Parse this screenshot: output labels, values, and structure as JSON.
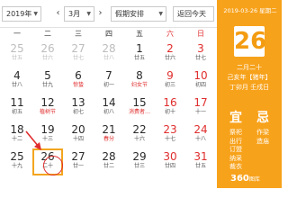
{
  "toolbar": {
    "year": "2019年",
    "prev_month_arrow": "‹",
    "month": "3月",
    "next_month_arrow": "›",
    "holiday_schedule": "假期安排",
    "back_today": "返回今天"
  },
  "weekdays": [
    "一",
    "二",
    "三",
    "四",
    "五",
    "六",
    "日"
  ],
  "weeks": [
    [
      {
        "d": "25",
        "l": "廿五",
        "o": true
      },
      {
        "d": "26",
        "l": "廿六",
        "o": true
      },
      {
        "d": "27",
        "l": "廿七",
        "o": true
      },
      {
        "d": "28",
        "l": "廿八",
        "o": true
      },
      {
        "d": "1",
        "l": "廿五"
      },
      {
        "d": "2",
        "l": "廿六",
        "w": true
      },
      {
        "d": "3",
        "l": "廿七",
        "w": true
      }
    ],
    [
      {
        "d": "4",
        "l": "廿八"
      },
      {
        "d": "5",
        "l": "廿九"
      },
      {
        "d": "6",
        "l": "惊蛰",
        "f": true
      },
      {
        "d": "7",
        "l": "初一"
      },
      {
        "d": "8",
        "l": "妇女节",
        "f": true
      },
      {
        "d": "9",
        "l": "初三",
        "w": true
      },
      {
        "d": "10",
        "l": "初四",
        "w": true
      }
    ],
    [
      {
        "d": "11",
        "l": "初五"
      },
      {
        "d": "12",
        "l": "植树节",
        "f": true
      },
      {
        "d": "13",
        "l": "初七"
      },
      {
        "d": "14",
        "l": "初八"
      },
      {
        "d": "15",
        "l": "消费者…",
        "f": true
      },
      {
        "d": "16",
        "l": "初十",
        "w": true
      },
      {
        "d": "17",
        "l": "十一",
        "w": true
      }
    ],
    [
      {
        "d": "18",
        "l": "十二"
      },
      {
        "d": "19",
        "l": "十三"
      },
      {
        "d": "20",
        "l": "十四"
      },
      {
        "d": "21",
        "l": "春分",
        "f": true
      },
      {
        "d": "22",
        "l": "十六"
      },
      {
        "d": "23",
        "l": "十七",
        "w": true
      },
      {
        "d": "24",
        "l": "十八",
        "w": true
      }
    ],
    [
      {
        "d": "25",
        "l": "十九"
      },
      {
        "d": "26",
        "l": "二十",
        "s": true
      },
      {
        "d": "27",
        "l": "廿一"
      },
      {
        "d": "28",
        "l": "廿二"
      },
      {
        "d": "29",
        "l": "廿三"
      },
      {
        "d": "30",
        "l": "廿四",
        "w": true
      },
      {
        "d": "31",
        "l": "廿五",
        "w": true
      }
    ]
  ],
  "panel": {
    "date_line": "2019-03-26 星期二",
    "big_day": "26",
    "lunar_date": "二月二十",
    "ganzhi_year": "己亥年【猪年】",
    "ganzhi_month_day": "丁卯月 壬戌日",
    "yi_label": "宜",
    "ji_label": "忌",
    "yi_items": [
      "祭祀",
      "出行",
      "订盟",
      "纳采",
      "裁衣"
    ],
    "ji_items": [
      "作梁",
      "造庙"
    ]
  },
  "logo": "360",
  "watermark": "图库"
}
